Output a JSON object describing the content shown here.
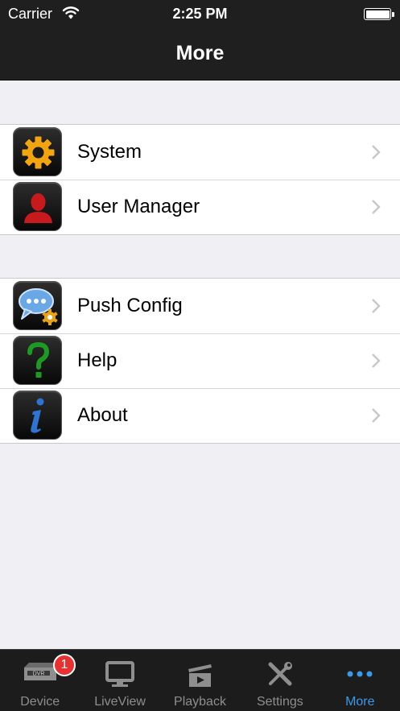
{
  "status_bar": {
    "carrier": "Carrier",
    "time": "2:25 PM",
    "wifi_icon": "wifi-icon",
    "battery_icon": "battery-icon"
  },
  "nav": {
    "title": "More"
  },
  "groups": [
    {
      "items": [
        {
          "label": "System",
          "icon": "gear-icon"
        },
        {
          "label": "User Manager",
          "icon": "user-icon"
        }
      ]
    },
    {
      "items": [
        {
          "label": "Push Config",
          "icon": "chat-bubbles-gear-icon"
        },
        {
          "label": "Help",
          "icon": "question-mark-icon"
        },
        {
          "label": "About",
          "icon": "info-icon"
        }
      ]
    }
  ],
  "tab_bar": {
    "active_color": "#3a99e8",
    "tabs": [
      {
        "label": "Device",
        "icon": "dvr-icon",
        "badge": "1",
        "badge_text": "DVR"
      },
      {
        "label": "LiveView",
        "icon": "monitor-icon"
      },
      {
        "label": "Playback",
        "icon": "film-clapper-icon"
      },
      {
        "label": "Settings",
        "icon": "tools-icon"
      },
      {
        "label": "More",
        "icon": "more-dots-icon",
        "active": true
      }
    ]
  }
}
